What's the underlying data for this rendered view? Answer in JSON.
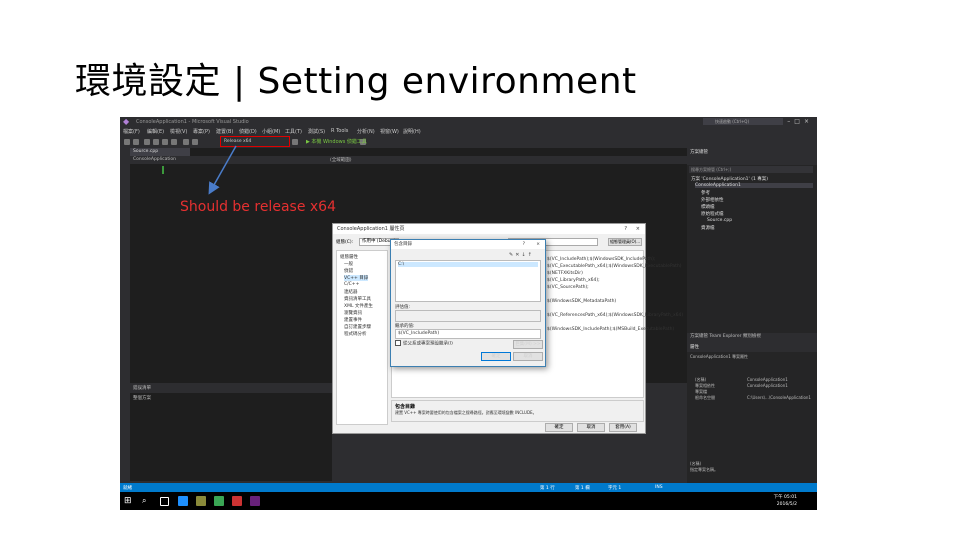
{
  "slide": {
    "title": "環境設定 | Setting environment",
    "annotation": "Should be release x64",
    "annotation_color": "#e53030"
  },
  "vs": {
    "window_title": "ConsoleApplication1 - Microsoft Visual Studio",
    "quick_launch": "快速啟動 (Ctrl+Q)",
    "menus": [
      "檔案(F)",
      "編輯(E)",
      "檢視(V)",
      "專案(P)",
      "建置(B)",
      "偵錯(D)",
      "小組(M)",
      "工具(T)",
      "測試(S)",
      "R Tools",
      "分析(N)",
      "視窗(W)",
      "說明(H)"
    ],
    "configuration": "Release   x64",
    "start_label": "▶ 本機 Windows 偵錯工具",
    "editor_tab": "Source.cpp",
    "editor_scope": "ConsoleApplication",
    "editor_scope2": "(全域範圍)",
    "output_title": "錯誤清單",
    "output_sub": "整個方案",
    "solution": {
      "title": "方案總管",
      "search_placeholder": "搜尋方案總管 (Ctrl+;)",
      "items": [
        "方案 'ConsoleApplication1' (1 專案)",
        "ConsoleApplication1",
        "參考",
        "外部相依性",
        "標頭檔",
        "原始程式檔",
        "Source.cpp",
        "資源檔"
      ]
    },
    "bottom_tabs": "方案總管   Team Explorer   類別檢視",
    "properties": {
      "title": "屬性",
      "object": "ConsoleApplication1 專案屬性",
      "lines": [
        "(名稱)",
        "專案相依性",
        "專案檔",
        "根命名空間"
      ],
      "values": [
        "ConsoleApplication1",
        "ConsoleApplication1",
        "",
        "C:\\Users\\...\\ConsoleApplication1"
      ]
    },
    "props_footer": "(名稱)",
    "props_footer2": "指定專案名稱。",
    "status_items": [
      "就緒",
      "第 1 行",
      "第 1 欄",
      "字元 1",
      "INS"
    ],
    "clock_time": "下午 05:01",
    "clock_date": "2016/5/2"
  },
  "dialog": {
    "title": "ConsoleApplication1 屬性頁",
    "config_label": "組態(C):",
    "config_value": "作用中 (Debug)",
    "platform_label": "平台(P):",
    "config_manager": "組態管理員(O)...",
    "tree": [
      "組態屬性",
      "一般",
      "偵錯",
      "VC++ 目錄",
      "C/C++",
      "連結器",
      "資訊清單工具",
      "XML 文件產生",
      "瀏覽資訊",
      "建置事件",
      "自訂建置步驟",
      "程式碼分析"
    ],
    "grid_lines": [
      "$(VC_IncludePath);$(WindowsSDK_IncludePath);",
      "$(VC_ExecutablePath_x64);$(WindowsSDK_ExecutablePath)",
      "$(NETFXKitsDir)",
      "$(VC_LibraryPath_x64);",
      "$(VC_SourcePath);",
      "",
      "$(WindowsSDK_MetadataPath)",
      "",
      "$(VC_ReferencesPath_x64);$(WindowsSDK_LibraryPath_x64)",
      "",
      "$(WindowsSDK_IncludePath);$(MSBuild_ExecutablePath)"
    ],
    "desc_title": "包含目錄",
    "desc_text": "建置 VC++ 專案時要使用的包含檔案之搜尋路徑。對應至環境變數 INCLUDE。",
    "btn_ok": "確定",
    "btn_cancel": "取消",
    "btn_apply": "套用(A)"
  },
  "subdialog": {
    "title": "包含目錄",
    "line1": "C:\\",
    "eval_label": "評估值:",
    "inherit_label": "繼承的值:",
    "inherit_values": [
      "$(VC_IncludePath)",
      "$(WindowsSDK_IncludePath)"
    ],
    "checkbox": "從父系或專案預設繼承(I)",
    "macros": "巨集(M) >>",
    "btn_ok": "確定",
    "btn_cancel": "取消"
  },
  "colors": {
    "vs_background": "#2d2d30",
    "editor_background": "#1e1e1e",
    "statusbar": "#007acc",
    "highlight_box": "#e00000",
    "arrow": "#4a7cc9"
  }
}
